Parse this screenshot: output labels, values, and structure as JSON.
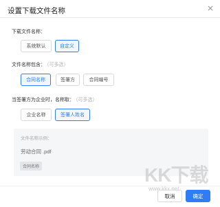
{
  "dialog": {
    "title": "设置下载文件名称",
    "close_icon": "close-icon"
  },
  "file_name_section": {
    "label": "下载文件名称：",
    "options": [
      {
        "label": "系统默认",
        "selected": false
      },
      {
        "label": "自定义",
        "selected": true
      }
    ]
  },
  "contains_section": {
    "label": "文件名称包含：",
    "hint": "（可多选）",
    "options": [
      {
        "label": "合同名称",
        "selected": true
      },
      {
        "label": "签署方",
        "selected": false
      },
      {
        "label": "合同编号",
        "selected": false
      }
    ]
  },
  "signer_section": {
    "label": "当签署方为企业时，名称取：",
    "hint": "（可多选）",
    "options": [
      {
        "label": "企业名称",
        "selected": false
      },
      {
        "label": "签署人姓名",
        "selected": true
      }
    ]
  },
  "preview": {
    "label": "文件名称示例：",
    "example": "劳动合同  .pdf",
    "tag": "合同名称"
  },
  "footer": {
    "cancel_label": "取消",
    "ok_label": "确定"
  },
  "watermark": {
    "logo_text": "KK下载",
    "url": "www.kkx.net"
  },
  "colors": {
    "accent": "#2f7df6",
    "selected_bg": "#f2f7ff"
  }
}
